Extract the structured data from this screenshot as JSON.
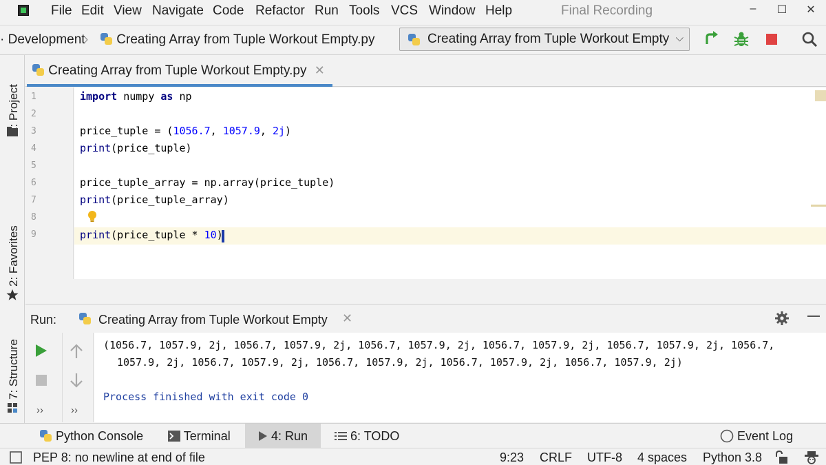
{
  "menu": {
    "items": [
      "File",
      "Edit",
      "View",
      "Navigate",
      "Code",
      "Refactor",
      "Run",
      "Tools",
      "VCS",
      "Window",
      "Help"
    ],
    "window_title": "Final Recording",
    "minimize": "–",
    "maximize": "☐",
    "close": "✕"
  },
  "nav": {
    "breadcrumb_project": "Development",
    "breadcrumb_sep": "›",
    "breadcrumb_file": "Creating Array from Tuple Workout Empty.py",
    "run_config": "Creating Array from Tuple Workout Empty",
    "run_config_chevron": "⌵"
  },
  "toolbar": {
    "accent_run": "#3aa03a",
    "accent_stop": "#e04343"
  },
  "left_strip": {
    "project": "1: Project",
    "favorites": "2: Favorites",
    "structure": "7: Structure"
  },
  "editor": {
    "tab_title": "Creating Array from Tuple Workout Empty.py",
    "tab_close": "✕",
    "line_numbers": [
      "1",
      "2",
      "3",
      "4",
      "5",
      "6",
      "7",
      "8",
      "9"
    ],
    "lines": [
      "import numpy as np",
      "",
      "price_tuple = (1056.7, 1057.9, 2j)",
      "print(price_tuple)",
      "",
      "price_tuple_array = np.array(price_tuple)",
      "print(price_tuple_array)",
      "",
      "print(price_tuple * 10)"
    ]
  },
  "run_panel": {
    "label": "Run:",
    "tab_title": "Creating Array from Tuple Workout Empty",
    "tab_close": "✕",
    "output_line1": "(1056.7, 1057.9, 2j, 1056.7, 1057.9, 2j, 1056.7, 1057.9, 2j, 1056.7, 1057.9, 2j, 1056.7, 1057.9, 2j, 1056.7,",
    "output_line2": "1057.9, 2j, 1056.7, 1057.9, 2j, 1056.7, 1057.9, 2j, 1056.7, 1057.9, 2j, 1056.7, 1057.9, 2j)",
    "exit_message": "Process finished with exit code 0",
    "more1": "››",
    "more2": "››"
  },
  "tool_tabs": {
    "python_console": "Python Console",
    "terminal": "Terminal",
    "run": "4: Run",
    "todo": "6: TODO",
    "event_log": "Event Log"
  },
  "status": {
    "message": "PEP 8: no newline at end of file",
    "position": "9:23",
    "line_sep": "CRLF",
    "encoding": "UTF-8",
    "indent": "4 spaces",
    "interpreter": "Python 3.8"
  }
}
